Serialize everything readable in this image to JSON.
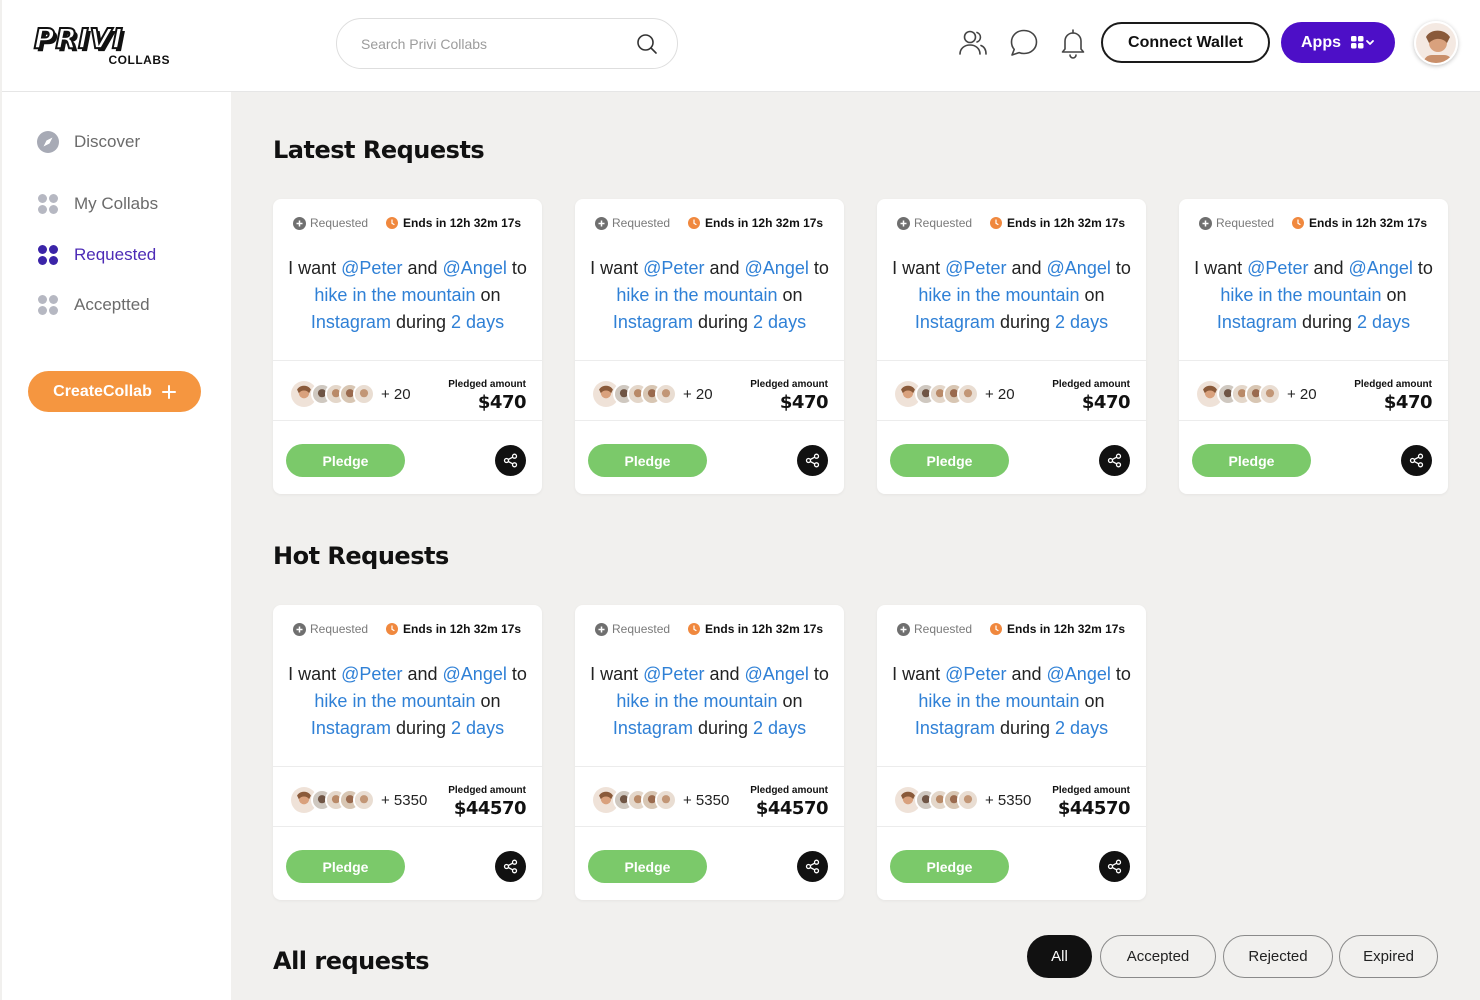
{
  "logo": {
    "word": "PRIVI",
    "sub": "COLLABS"
  },
  "search": {
    "placeholder": "Search Privi Collabs"
  },
  "header": {
    "connect_label": "Connect Wallet",
    "apps_label": "Apps"
  },
  "sidebar": {
    "items": [
      {
        "label": "Discover",
        "icon": "compass-icon"
      },
      {
        "label": "My Collabs",
        "icon": "grid-icon"
      },
      {
        "label": "Requested",
        "icon": "grid-icon",
        "active": true
      },
      {
        "label": "Acceptted",
        "icon": "grid-icon"
      }
    ],
    "create_label": "CreateCollab"
  },
  "colors": {
    "accent": "#4d0fc7",
    "orange": "#f59640",
    "green": "#7bc96a",
    "link": "#2f80d6"
  },
  "latest": {
    "title": "Latest Requests",
    "cards": [
      {
        "status": "Requested",
        "ends": "Ends in 12h 32m 17s",
        "t1": "I want",
        "u1": "@Peter",
        "t2": "and",
        "u2": "@Angel",
        "t3": "to",
        "activity": "hike in the mountain",
        "t4": "on",
        "platform": "Instagram",
        "t5": "during",
        "duration": "2 days",
        "count": "+ 20",
        "pledged_label": "Pledged amount",
        "amount": "$470",
        "pledge_label": "Pledge"
      },
      {
        "status": "Requested",
        "ends": "Ends in 12h 32m 17s",
        "t1": "I want",
        "u1": "@Peter",
        "t2": "and",
        "u2": "@Angel",
        "t3": "to",
        "activity": "hike in the mountain",
        "t4": "on",
        "platform": "Instagram",
        "t5": "during",
        "duration": "2 days",
        "count": "+ 20",
        "pledged_label": "Pledged amount",
        "amount": "$470",
        "pledge_label": "Pledge"
      },
      {
        "status": "Requested",
        "ends": "Ends in 12h 32m 17s",
        "t1": "I want",
        "u1": "@Peter",
        "t2": "and",
        "u2": "@Angel",
        "t3": "to",
        "activity": "hike in the mountain",
        "t4": "on",
        "platform": "Instagram",
        "t5": "during",
        "duration": "2 days",
        "count": "+ 20",
        "pledged_label": "Pledged amount",
        "amount": "$470",
        "pledge_label": "Pledge"
      },
      {
        "status": "Requested",
        "ends": "Ends in 12h 32m 17s",
        "t1": "I want",
        "u1": "@Peter",
        "t2": "and",
        "u2": "@Angel",
        "t3": "to",
        "activity": "hike in the mountain",
        "t4": "on",
        "platform": "Instagram",
        "t5": "during",
        "duration": "2 days",
        "count": "+ 20",
        "pledged_label": "Pledged amount",
        "amount": "$470",
        "pledge_label": "Pledge"
      }
    ]
  },
  "hot": {
    "title": "Hot Requests",
    "cards": [
      {
        "status": "Requested",
        "ends": "Ends in 12h 32m 17s",
        "t1": "I want",
        "u1": "@Peter",
        "t2": "and",
        "u2": "@Angel",
        "t3": "to",
        "activity": "hike in the mountain",
        "t4": "on",
        "platform": "Instagram",
        "t5": "during",
        "duration": "2 days",
        "count": "+ 5350",
        "pledged_label": "Pledged amount",
        "amount": "$44570",
        "pledge_label": "Pledge"
      },
      {
        "status": "Requested",
        "ends": "Ends in 12h 32m 17s",
        "t1": "I want",
        "u1": "@Peter",
        "t2": "and",
        "u2": "@Angel",
        "t3": "to",
        "activity": "hike in the mountain",
        "t4": "on",
        "platform": "Instagram",
        "t5": "during",
        "duration": "2 days",
        "count": "+ 5350",
        "pledged_label": "Pledged amount",
        "amount": "$44570",
        "pledge_label": "Pledge"
      },
      {
        "status": "Requested",
        "ends": "Ends in 12h 32m 17s",
        "t1": "I want",
        "u1": "@Peter",
        "t2": "and",
        "u2": "@Angel",
        "t3": "to",
        "activity": "hike in the mountain",
        "t4": "on",
        "platform": "Instagram",
        "t5": "during",
        "duration": "2 days",
        "count": "+ 5350",
        "pledged_label": "Pledged amount",
        "amount": "$44570",
        "pledge_label": "Pledge"
      }
    ]
  },
  "all": {
    "title": "All requests",
    "filters": [
      {
        "label": "All",
        "active": true
      },
      {
        "label": "Accepted"
      },
      {
        "label": "Rejected"
      },
      {
        "label": "Expired"
      }
    ]
  }
}
